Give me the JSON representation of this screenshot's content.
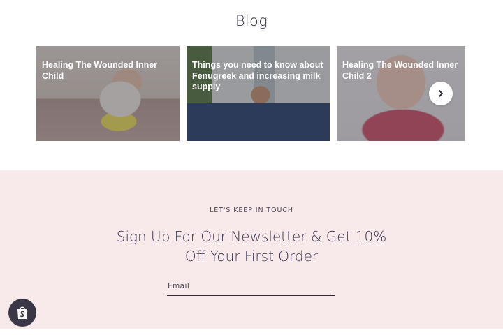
{
  "blog": {
    "heading": "Blog",
    "cards": [
      {
        "title": "Healing The Wounded Inner Child"
      },
      {
        "title": "Things you need to know about Fenugreek and increasing milk supply"
      },
      {
        "title": "Healing The Wounded Inner Child 2"
      }
    ],
    "next_icon": "chevron-right-icon"
  },
  "newsletter": {
    "eyebrow": "LET'S KEEP IN TOUCH",
    "headline": "Sign Up For Our Newsletter & Get 10% Off Your First Order",
    "email_placeholder": "Email"
  },
  "shop_badge": {
    "icon": "shopping-bag-icon"
  },
  "colors": {
    "newsletter_bg": "#f8eaea",
    "heading_text": "#3a3550",
    "badge_bg": "#3b3746"
  }
}
